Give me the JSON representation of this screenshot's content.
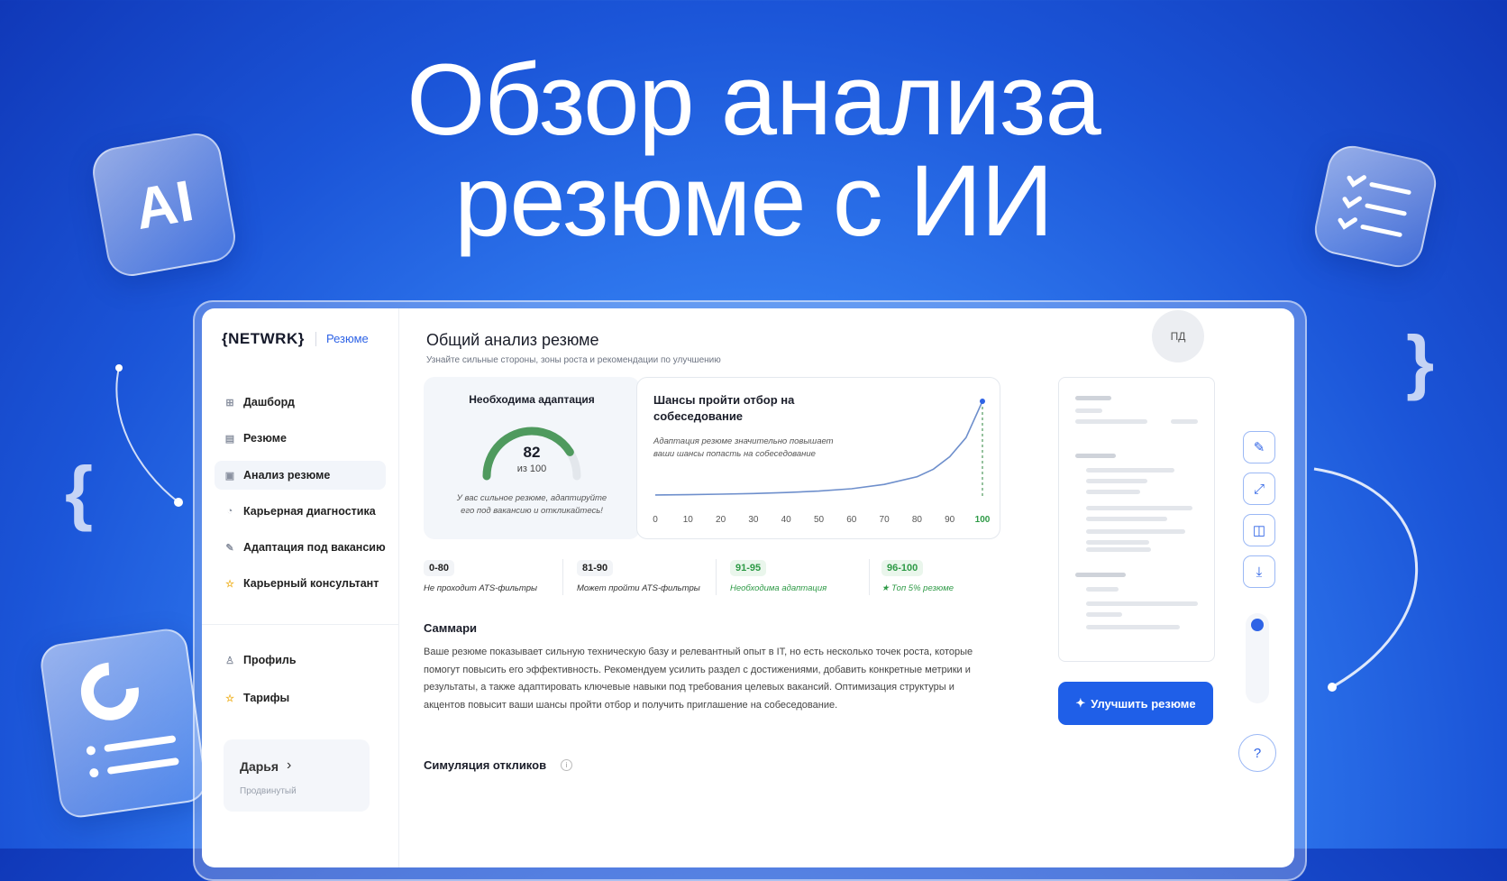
{
  "hero": {
    "title_line1": "Обзор анализа",
    "title_line2": "резюме с ИИ",
    "ai_badge": "AI"
  },
  "sidebar": {
    "logo": "{NETWRK}",
    "logo_section": "Резюме",
    "items": [
      {
        "label": "Дашборд",
        "icon": "grid-icon"
      },
      {
        "label": "Резюме",
        "icon": "document-icon"
      },
      {
        "label": "Анализ резюме",
        "icon": "analysis-icon",
        "active": true
      },
      {
        "label": "Карьерная диагностика",
        "icon": "diagnostic-icon"
      },
      {
        "label": "Адаптация под вакансию",
        "icon": "edit-icon"
      },
      {
        "label": "Карьерный консультант",
        "icon": "star-icon"
      }
    ],
    "bottom_items": [
      {
        "label": "Профиль",
        "icon": "user-icon"
      },
      {
        "label": "Тарифы",
        "icon": "star-icon"
      }
    ],
    "user": {
      "name": "Дарья",
      "plan": "Продвинутый"
    }
  },
  "header": {
    "title": "Общий анализ резюме",
    "subtitle": "Узнайте сильные стороны, зоны роста и рекомендации по улучшению",
    "avatar_initials": "ПД"
  },
  "score": {
    "heading": "Необходима адаптация",
    "value": "82",
    "of_label": "из 100",
    "value_fraction": 0.82,
    "note": "У вас сильное резюме, адаптируйте его под вакансию и откликайтесь!",
    "color": "#4f9a5e"
  },
  "chart_data": {
    "type": "line",
    "title": "Шансы пройти отбор на собеседование",
    "subtitle": "Адаптация резюме значительно повышает ваши шансы попасть на собеседование",
    "x_ticks": [
      "0",
      "10",
      "20",
      "30",
      "40",
      "50",
      "60",
      "70",
      "80",
      "90",
      "100"
    ],
    "xlim": [
      0,
      100
    ],
    "highlight_x": 100,
    "series": [
      {
        "x": [
          0,
          10,
          20,
          30,
          40,
          50,
          60,
          70,
          80,
          85,
          90,
          95,
          100
        ],
        "y": [
          2,
          2.3,
          2.8,
          3.5,
          4.5,
          6,
          8.5,
          13,
          21,
          29,
          42,
          62,
          100
        ]
      }
    ],
    "ylim": [
      0,
      100
    ],
    "line_color": "#6e8fcc"
  },
  "legend": [
    {
      "range": "0-80",
      "desc": "Не проходит ATS-фильтры",
      "green": false
    },
    {
      "range": "81-90",
      "desc": "Может пройти ATS-фильтры",
      "green": false
    },
    {
      "range": "91-95",
      "desc": "Необходима адаптация",
      "green": true
    },
    {
      "range": "96-100",
      "desc": "Топ 5% резюме",
      "green": true,
      "star": "★"
    }
  ],
  "summary": {
    "heading": "Саммари",
    "text": "Ваше резюме показывает сильную техническую базу и релевантный опыт в IT, но есть несколько точек роста, которые помогут повысить его эффективность. Рекомендуем усилить раздел с достижениями, добавить конкретные метрики и результаты, а также адаптировать ключевые навыки под требования целевых вакансий. Оптимизация структуры и акцентов повысит ваши шансы пройти отбор и получить приглашение на собеседование."
  },
  "simulation": {
    "heading": "Симуляция откликов",
    "info": "i"
  },
  "actions": {
    "improve_label": "Улучшить резюме",
    "help": "?",
    "tools": [
      "edit-icon",
      "expand-icon",
      "compare-icon",
      "download-icon"
    ]
  }
}
